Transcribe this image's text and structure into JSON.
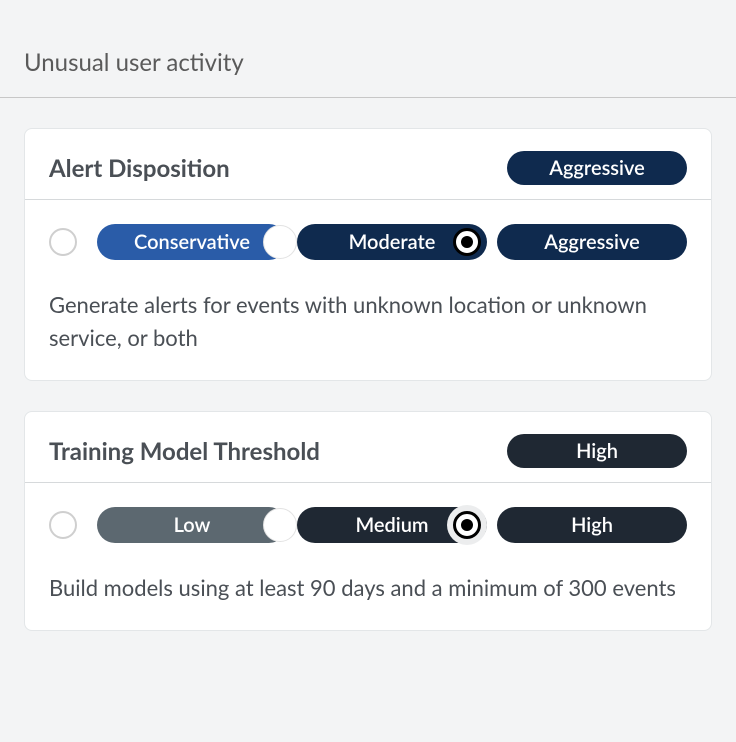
{
  "page": {
    "title": "Unusual user activity"
  },
  "alert": {
    "title": "Alert Disposition",
    "current": "Aggressive",
    "options": {
      "low": "Conservative",
      "mid": "Moderate",
      "high": "Aggressive"
    },
    "description": "Generate alerts for events with unknown location or unknown service, or both"
  },
  "training": {
    "title": "Training Model Threshold",
    "current": "High",
    "options": {
      "low": "Low",
      "mid": "Medium",
      "high": "High"
    },
    "description": "Build models using at least 90 days and a minimum of 300 events"
  }
}
